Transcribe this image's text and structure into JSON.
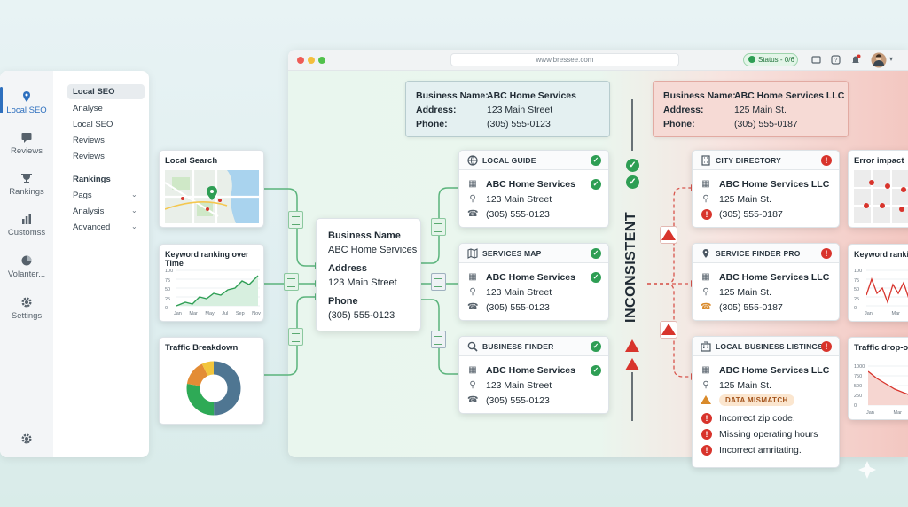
{
  "sidebar": {
    "icons": [
      {
        "label": "Local SEO",
        "icon": "location-pin-icon"
      },
      {
        "label": "Reviews",
        "icon": "chat-icon"
      },
      {
        "label": "Rankings",
        "icon": "trophy-icon"
      },
      {
        "label": "Customss",
        "icon": "bar-chart-icon"
      },
      {
        "label": "Volanter...",
        "icon": "pie-chart-icon"
      },
      {
        "label": "Settings",
        "icon": "gear-icon"
      }
    ],
    "menu": {
      "selected": "Local SEO",
      "items1": [
        "Analyse",
        "Local SEO",
        "Reviews",
        "Reviews"
      ],
      "header2": "Rankings",
      "items2": [
        "Pags",
        "Analysis",
        "Advanced"
      ]
    }
  },
  "browser": {
    "url": "www.bressee.com",
    "status": "Status - 0/6"
  },
  "widgets": {
    "local_search": "Local Search",
    "keyword_ranking": {
      "title": "Keyword ranking over Time",
      "y_ticks": [
        "100",
        "75",
        "50",
        "25",
        "0"
      ],
      "x_ticks": [
        "Jan",
        "Mar",
        "May",
        "Jul",
        "Sep",
        "Nov"
      ]
    },
    "traffic": {
      "title": "Traffic Breakdown"
    }
  },
  "source_card": {
    "name_label": "Business Name",
    "name": "ABC Home Services",
    "address_label": "Address",
    "address": "123 Main Street",
    "phone_label": "Phone",
    "phone": "(305) 555-0123"
  },
  "consistent_banner": {
    "name_label": "Business Name:",
    "name": "ABC Home Services",
    "address_label": "Address:",
    "address": "123 Main Street",
    "phone_label": "Phone:",
    "phone": "(305) 555-0123"
  },
  "inconsistent_banner": {
    "name_label": "Business Name:",
    "name": "ABC Home Services LLC",
    "address_label": "Address:",
    "address": "125 Main St.",
    "phone_label": "Phone:",
    "phone": "(305) 555-0187"
  },
  "divider_label": "INCONSISTENT",
  "listings_ok": [
    {
      "title": "LOCAL GUIDE",
      "name": "ABC Home Services",
      "address": "123 Main Street",
      "phone": "(305) 555-0123"
    },
    {
      "title": "SERVICES MAP",
      "name": "ABC Home Services",
      "address": "123 Main Street",
      "phone": "(305) 555-0123"
    },
    {
      "title": "BUSINESS FINDER",
      "name": "ABC Home Services",
      "address": "123 Main Street",
      "phone": "(305) 555-0123"
    }
  ],
  "listings_bad": [
    {
      "title": "CITY DIRECTORY",
      "name": "ABC Home Services LLC",
      "address": "125 Main St.",
      "phone": "(305) 555-0187"
    },
    {
      "title": "SERVICE FINDER PRO",
      "name": "ABC Home Services LLC",
      "address": "125 Main St.",
      "phone": "(305) 555-0187"
    },
    {
      "title": "LOCAL BUSINESS LISTINGS",
      "name": "ABC Home Services LLC",
      "address": "125 Main St.",
      "badge": "DATA MISMATCH",
      "errors": [
        "Incorrect zip code.",
        "Missing operating hours",
        "Incorrect amritating."
      ]
    }
  ],
  "right_widgets": {
    "error_impact": "Error impact",
    "keyword": {
      "title": "Keyword ranking",
      "y_ticks": [
        "100",
        "75",
        "50",
        "25",
        "0"
      ],
      "x_ticks": [
        "Jan",
        "Mar"
      ]
    },
    "traffic_drop": {
      "title": "Traffic drop-off",
      "y_ticks": [
        "1000",
        "750",
        "500",
        "250",
        "0"
      ],
      "x_ticks": [
        "Jan",
        "Mar"
      ]
    }
  },
  "colors": {
    "accent": "#2d6fbe",
    "ok": "#2e9e54",
    "error": "#d8342c"
  }
}
